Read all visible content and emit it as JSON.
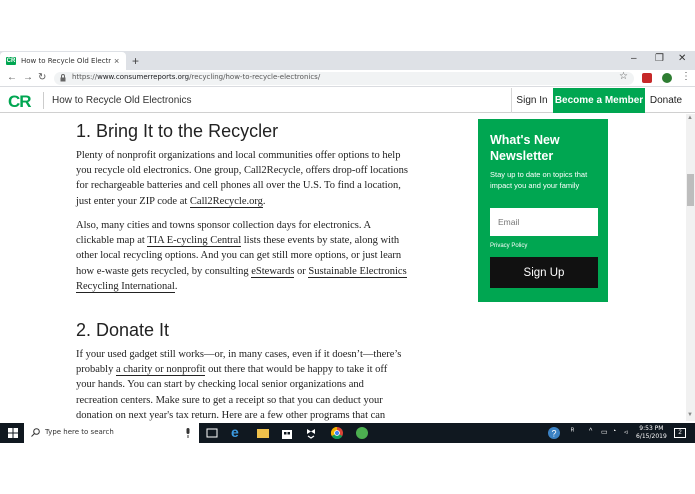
{
  "browser": {
    "tab_title": "How to Recycle Old Electronics -",
    "tab_favicon_text": "CR",
    "new_tab": "+",
    "close_tab": "×",
    "win_min": "–",
    "win_max": "❐",
    "win_close": "✕",
    "url_scheme": "https://",
    "url_host": "www.consumerreports.org",
    "url_path": "/recycling/how-to-recycle-electronics/"
  },
  "header": {
    "logo": "CR",
    "title": "How to Recycle Old Electronics",
    "sign_in": "Sign In",
    "member": "Become a Member",
    "donate": "Donate",
    "accent": "#00a651"
  },
  "article": {
    "sec1_heading": "1. Bring It to the Recycler",
    "p1_l1": "Plenty of nonprofit organizations and local communities offer options to help",
    "p1_l2": "you recycle old electronics. One group, Call2Recycle, offers drop-off locations",
    "p1_l3": "for rechargeable batteries and cell phones all over the U.S. To find a location,",
    "p1_l4_a": "just enter your ZIP code at ",
    "p1_l4_link": "Call2Recycle.org",
    "p1_l4_b": ".",
    "p2_l1": "Also, many cities and towns sponsor collection days for electronics. A",
    "p2_l2_a": "clickable map at ",
    "p2_l2_link": "TIA E-cycling Central",
    "p2_l2_b": " lists these events by state, along with",
    "p2_l3": "other local recycling options. And you can get still more options, or just learn",
    "p2_l4_a": "how e-waste gets recycled, by consulting ",
    "p2_l4_link1": "eStewards",
    "p2_l4_b": " or ",
    "p2_l4_link2": "Sustainable Electronics",
    "p2_l5_link": "Recycling International",
    "p2_l5_b": ".",
    "sec2_heading": "2. Donate It",
    "p3_l1": "If your used gadget still works—or, in many cases, even if it doesn’t—there’s",
    "p3_l2_a": "probably ",
    "p3_l2_link": "a charity or nonprofit",
    "p3_l2_b": " out there that would be happy to take it off",
    "p3_l3": "your hands. You can start by checking local senior organizations and",
    "p3_l4": "recreation centers. Make sure to get a receipt so that you can deduct your",
    "p3_l5": "donation on next year's tax return. Here are a few other programs that can"
  },
  "newsletter": {
    "title": "What's New Newsletter",
    "desc": "Stay up to date on topics that impact you and your family",
    "email_placeholder": "Email",
    "privacy": "Privacy Policy",
    "signup": "Sign Up"
  },
  "taskbar": {
    "search_placeholder": "Type here to search",
    "time": "9:53 PM",
    "date": "6/15/2019",
    "notifications": "2"
  }
}
